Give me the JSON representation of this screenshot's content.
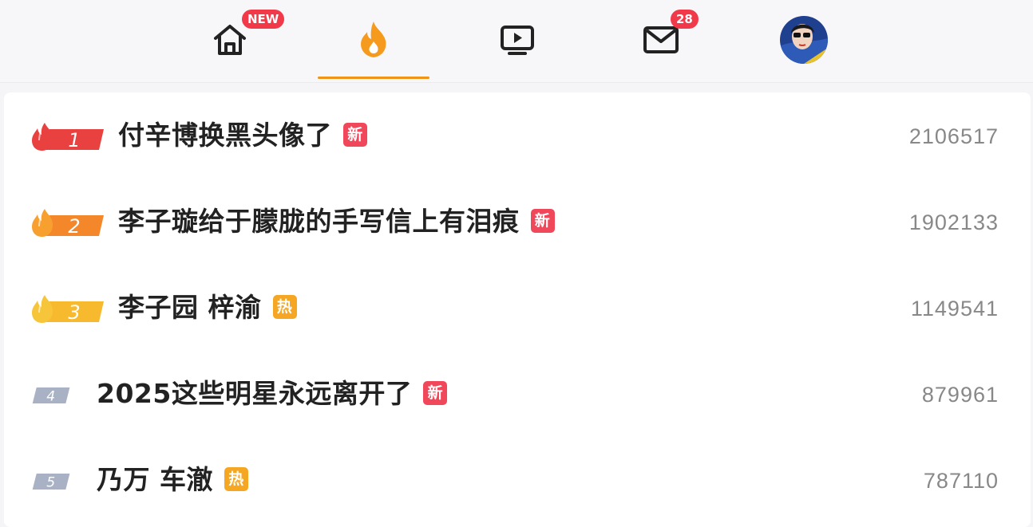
{
  "nav": {
    "home_badge": "NEW",
    "message_badge": "28",
    "accent_color": "#f09418"
  },
  "hot_list": [
    {
      "rank": "1",
      "title": "付辛博换黑头像了",
      "tag": "新",
      "tag_type": "new",
      "count": "2106517",
      "rank_color": "#e8413f"
    },
    {
      "rank": "2",
      "title": "李子璇给于朦胧的手写信上有泪痕",
      "tag": "新",
      "tag_type": "new",
      "count": "1902133",
      "rank_color": "#f5872b"
    },
    {
      "rank": "3",
      "title": "李子园 梓渝",
      "tag": "热",
      "tag_type": "hot",
      "count": "1149541",
      "rank_color": "#f7b92d"
    },
    {
      "rank": "4",
      "title": "2025这些明星永远离开了",
      "tag": "新",
      "tag_type": "new",
      "count": "879961",
      "rank_color": "#a8b2c4"
    },
    {
      "rank": "5",
      "title": "乃万 车澈",
      "tag": "热",
      "tag_type": "hot",
      "count": "787110",
      "rank_color": "#a8b2c4"
    }
  ]
}
